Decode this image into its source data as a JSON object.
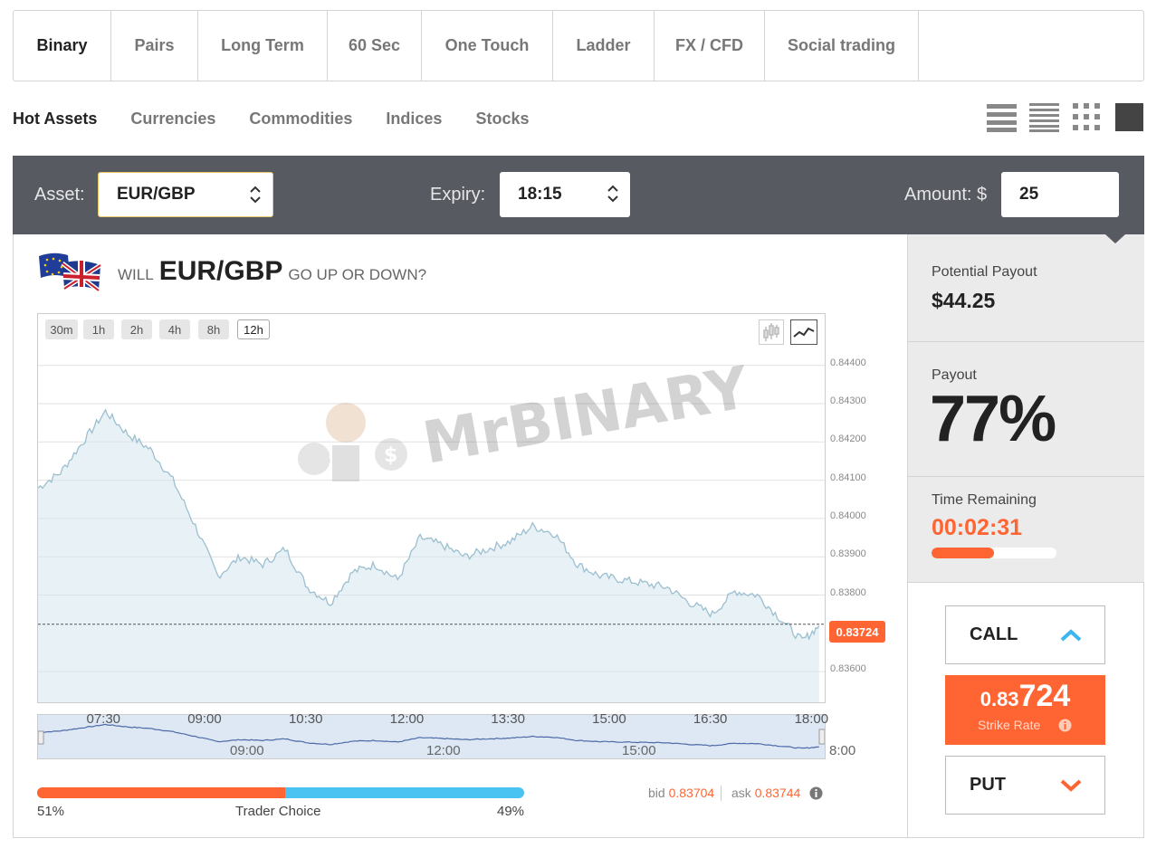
{
  "tabs": [
    "Binary",
    "Pairs",
    "Long Term",
    "60 Sec",
    "One Touch",
    "Ladder",
    "FX / CFD",
    "Social trading"
  ],
  "subtabs": [
    "Hot Assets",
    "Currencies",
    "Commodities",
    "Indices",
    "Stocks"
  ],
  "asset_bar": {
    "asset_label": "Asset:",
    "asset_value": "EUR/GBP",
    "expiry_label": "Expiry:",
    "expiry_value": "18:15",
    "amount_label": "Amount: $",
    "amount_value": "25"
  },
  "question": {
    "prefix": "WILL",
    "asset": "EUR/GBP",
    "suffix": "GO UP OR DOWN?"
  },
  "chart": {
    "ranges": [
      "30m",
      "1h",
      "2h",
      "4h",
      "8h",
      "12h"
    ],
    "active_range": "12h",
    "watermark": "MrBINARY",
    "current_price": "0.83724",
    "navigator_ticks": [
      "09:00",
      "12:00",
      "15:00",
      "8:00"
    ]
  },
  "chart_data": {
    "type": "area",
    "title": "",
    "xlabel": "",
    "ylabel": "",
    "x_ticks": [
      "07:30",
      "09:00",
      "10:30",
      "12:00",
      "13:30",
      "15:00",
      "16:30",
      "18:00"
    ],
    "y_ticks": [
      "0.84400",
      "0.84300",
      "0.84200",
      "0.84100",
      "0.84000",
      "0.83900",
      "0.83800",
      "0.83600"
    ],
    "ylim": [
      0.8352,
      0.8443
    ],
    "x": [
      "06:30",
      "06:50",
      "07:10",
      "07:30",
      "07:50",
      "08:10",
      "08:30",
      "08:50",
      "09:10",
      "09:30",
      "09:50",
      "10:10",
      "10:30",
      "10:50",
      "11:10",
      "11:30",
      "11:50",
      "12:10",
      "12:30",
      "12:50",
      "13:10",
      "13:30",
      "13:50",
      "14:10",
      "14:30",
      "14:50",
      "15:10",
      "15:30",
      "15:50",
      "16:10",
      "16:30",
      "16:50",
      "17:10",
      "17:30",
      "17:50",
      "18:05"
    ],
    "values": [
      0.8408,
      0.8412,
      0.842,
      0.8428,
      0.8422,
      0.8418,
      0.841,
      0.8398,
      0.8385,
      0.839,
      0.8388,
      0.8392,
      0.8382,
      0.8378,
      0.8386,
      0.8388,
      0.8384,
      0.8395,
      0.8393,
      0.839,
      0.8392,
      0.8394,
      0.8398,
      0.8396,
      0.8388,
      0.8385,
      0.8384,
      0.8383,
      0.8382,
      0.8378,
      0.8375,
      0.8381,
      0.838,
      0.8374,
      0.8368,
      0.8372
    ],
    "current": 0.83724
  },
  "trader_choice": {
    "label": "Trader Choice",
    "left_pct": "51%",
    "right_pct": "49%",
    "left_fraction": 0.51
  },
  "quote": {
    "bid_label": "bid",
    "bid": "0.83704",
    "ask_label": "ask",
    "ask": "0.83744"
  },
  "side": {
    "potential_label": "Potential Payout",
    "potential_value": "$44.25",
    "payout_label": "Payout",
    "payout_value": "77%",
    "time_label": "Time Remaining",
    "time_value": "00:02:31",
    "time_fraction": 0.5,
    "call_label": "CALL",
    "put_label": "PUT",
    "strike_small": "0.83",
    "strike_big": "724",
    "strike_label": "Strike Rate"
  },
  "colors": {
    "accent": "#ff6532",
    "blue": "#4ac3f2",
    "dark_bar": "#575a61"
  }
}
